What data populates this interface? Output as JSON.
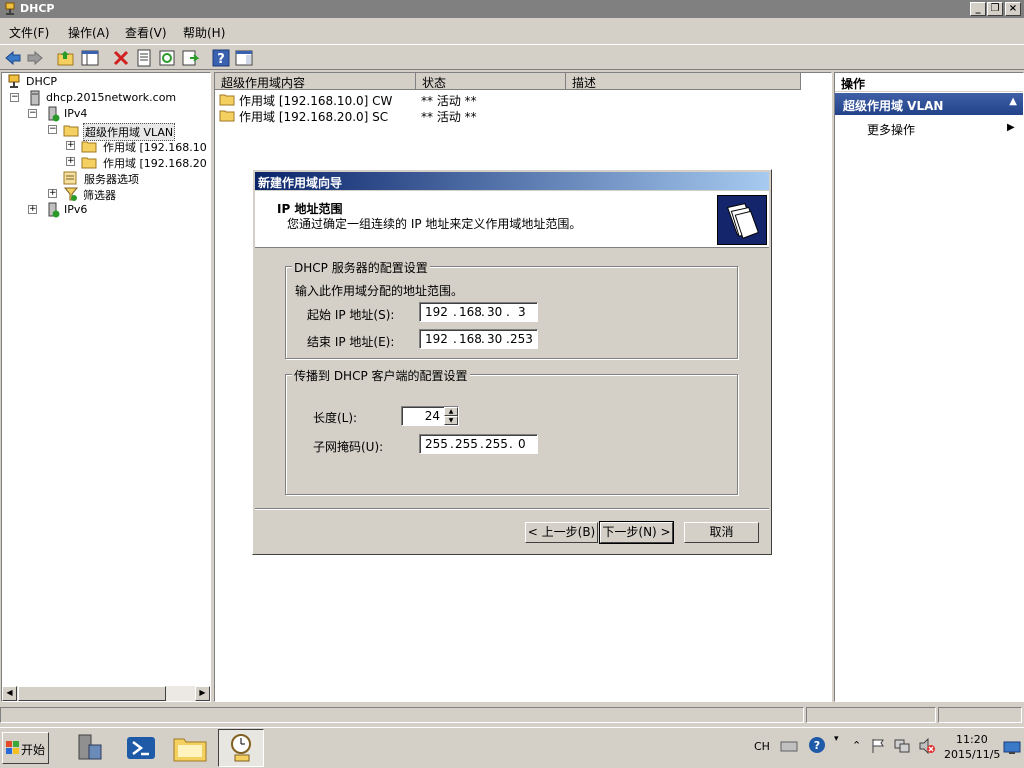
{
  "window": {
    "title": "DHCP"
  },
  "menu": {
    "file": "文件(F)",
    "action": "操作(A)",
    "view": "查看(V)",
    "help": "帮助(H)"
  },
  "toolbar": {
    "items": [
      "back-arrow-icon",
      "forward-arrow-icon",
      "up-folder-icon",
      "show-hide-tree-icon",
      "delete-icon",
      "properties-icon",
      "refresh-icon",
      "export-icon",
      "help-icon",
      "console-icon"
    ]
  },
  "tree": {
    "root": "DHCP",
    "server": "dhcp.2015network.com",
    "ipv4": "IPv4",
    "superscope": "超级作用域 VLAN",
    "scope1": "作用域 [192.168.10",
    "scope2": "作用域 [192.168.20",
    "server_options": "服务器选项",
    "filters": "筛选器",
    "ipv6": "IPv6"
  },
  "list": {
    "columns": [
      "超级作用域内容",
      "状态",
      "描述"
    ],
    "rows": [
      {
        "name": "作用域 [192.168.10.0] CW",
        "status": "** 活动 **"
      },
      {
        "name": "作用域 [192.168.20.0] SC",
        "status": "** 活动 **"
      }
    ]
  },
  "actions": {
    "header": "操作",
    "section": "超级作用域 VLAN",
    "more": "更多操作"
  },
  "wizard": {
    "title": "新建作用域向导",
    "heading": "IP 地址范围",
    "subheading": "您通过确定一组连续的 IP 地址来定义作用域地址范围。",
    "group1_title": "DHCP 服务器的配置设置",
    "group1_desc": "输入此作用域分配的地址范围。",
    "start_label": "起始 IP 地址(S):",
    "start_ip": [
      "192",
      "168",
      "30",
      "3"
    ],
    "end_label": "结束 IP 地址(E):",
    "end_ip": [
      "192",
      "168",
      "30",
      "253"
    ],
    "group2_title": "传播到 DHCP 客户端的配置设置",
    "length_label": "长度(L):",
    "length_value": "24",
    "mask_label": "子网掩码(U):",
    "mask": [
      "255",
      "255",
      "255",
      "0"
    ],
    "back": "< 上一步(B)",
    "next": "下一步(N) >",
    "cancel": "取消"
  },
  "taskbar": {
    "start": "开始",
    "lang": "CH",
    "time": "11:20",
    "date": "2015/11/5"
  },
  "colors": {
    "accent": "#22438a",
    "wizard_title": "#0a246a",
    "tray_alert": "#d33"
  }
}
